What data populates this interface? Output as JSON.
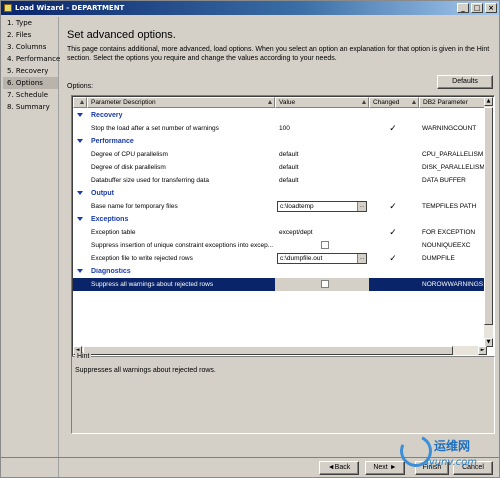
{
  "window": {
    "title": "Load Wizard - DEPARTMENT"
  },
  "nav": {
    "items": [
      {
        "label": "1. Type"
      },
      {
        "label": "2. Files"
      },
      {
        "label": "3. Columns"
      },
      {
        "label": "4. Performance"
      },
      {
        "label": "5. Recovery"
      },
      {
        "label": "6. Options",
        "active": true
      },
      {
        "label": "7. Schedule"
      },
      {
        "label": "8. Summary"
      }
    ]
  },
  "main": {
    "heading": "Set advanced options.",
    "intro": "This page contains additional, more advanced, load options.  When you select an option an explanation for that option is given in the Hint section.  Select the options you require and change the values according to your needs.",
    "options_label": "Options:",
    "defaults_label": "Defaults"
  },
  "grid": {
    "columns": [
      "Parameter Description",
      "Value",
      "Changed",
      "DB2 Parameter"
    ],
    "rows": [
      {
        "type": "category",
        "label": "Recovery"
      },
      {
        "type": "param",
        "desc": "Stop the load after a set number of warnings",
        "value": "100",
        "changed": true,
        "db2": "WARNINGCOUNT"
      },
      {
        "type": "category",
        "label": "Performance"
      },
      {
        "type": "param",
        "desc": "Degree of CPU parallelism",
        "value": "default",
        "changed": false,
        "db2": "CPU_PARALLELISM"
      },
      {
        "type": "param",
        "desc": "Degree of disk parallelism",
        "value": "default",
        "changed": false,
        "db2": "DISK_PARALLELISM"
      },
      {
        "type": "param",
        "desc": "Databuffer size used for transferring data",
        "value": "default",
        "changed": false,
        "db2": "DATA BUFFER"
      },
      {
        "type": "category",
        "label": "Output"
      },
      {
        "type": "param",
        "desc": "Base name for temporary files",
        "value": "c:\\loadtemp",
        "field": true,
        "changed": true,
        "db2": "TEMPFILES PATH"
      },
      {
        "type": "category",
        "label": "Exceptions"
      },
      {
        "type": "param",
        "desc": "Exception table",
        "value": "except/dept",
        "changed": true,
        "db2": "FOR EXCEPTION"
      },
      {
        "type": "param",
        "desc": "Suppress insertion of unique constraint exceptions into excep...",
        "value": "",
        "valuecheck": true,
        "changed": false,
        "db2": "NOUNIQUEEXC"
      },
      {
        "type": "param",
        "desc": "Exception file to write rejected rows",
        "value": "c:\\dumpfile.out",
        "field": true,
        "changed": true,
        "db2": "DUMPFILE"
      },
      {
        "type": "category",
        "label": "Diagnostics"
      },
      {
        "type": "param",
        "desc": "Suppress all warnings about rejected rows",
        "value": "",
        "valuecheck": true,
        "changed": false,
        "db2": "NOROWWARNINGS",
        "selected": true
      }
    ]
  },
  "hint": {
    "label": "Hint",
    "text": "Suppresses all warnings about rejected rows."
  },
  "footer": {
    "back": "◄Back",
    "next": "Next ►",
    "finish": "Finish",
    "cancel": "Cancel"
  },
  "watermark": {
    "line1": "运维网",
    "line2": "iyunv.com"
  },
  "colors": {
    "title_bar": "#0a246a",
    "category_text": "#1a3ca8",
    "selection": "#0a246a"
  }
}
